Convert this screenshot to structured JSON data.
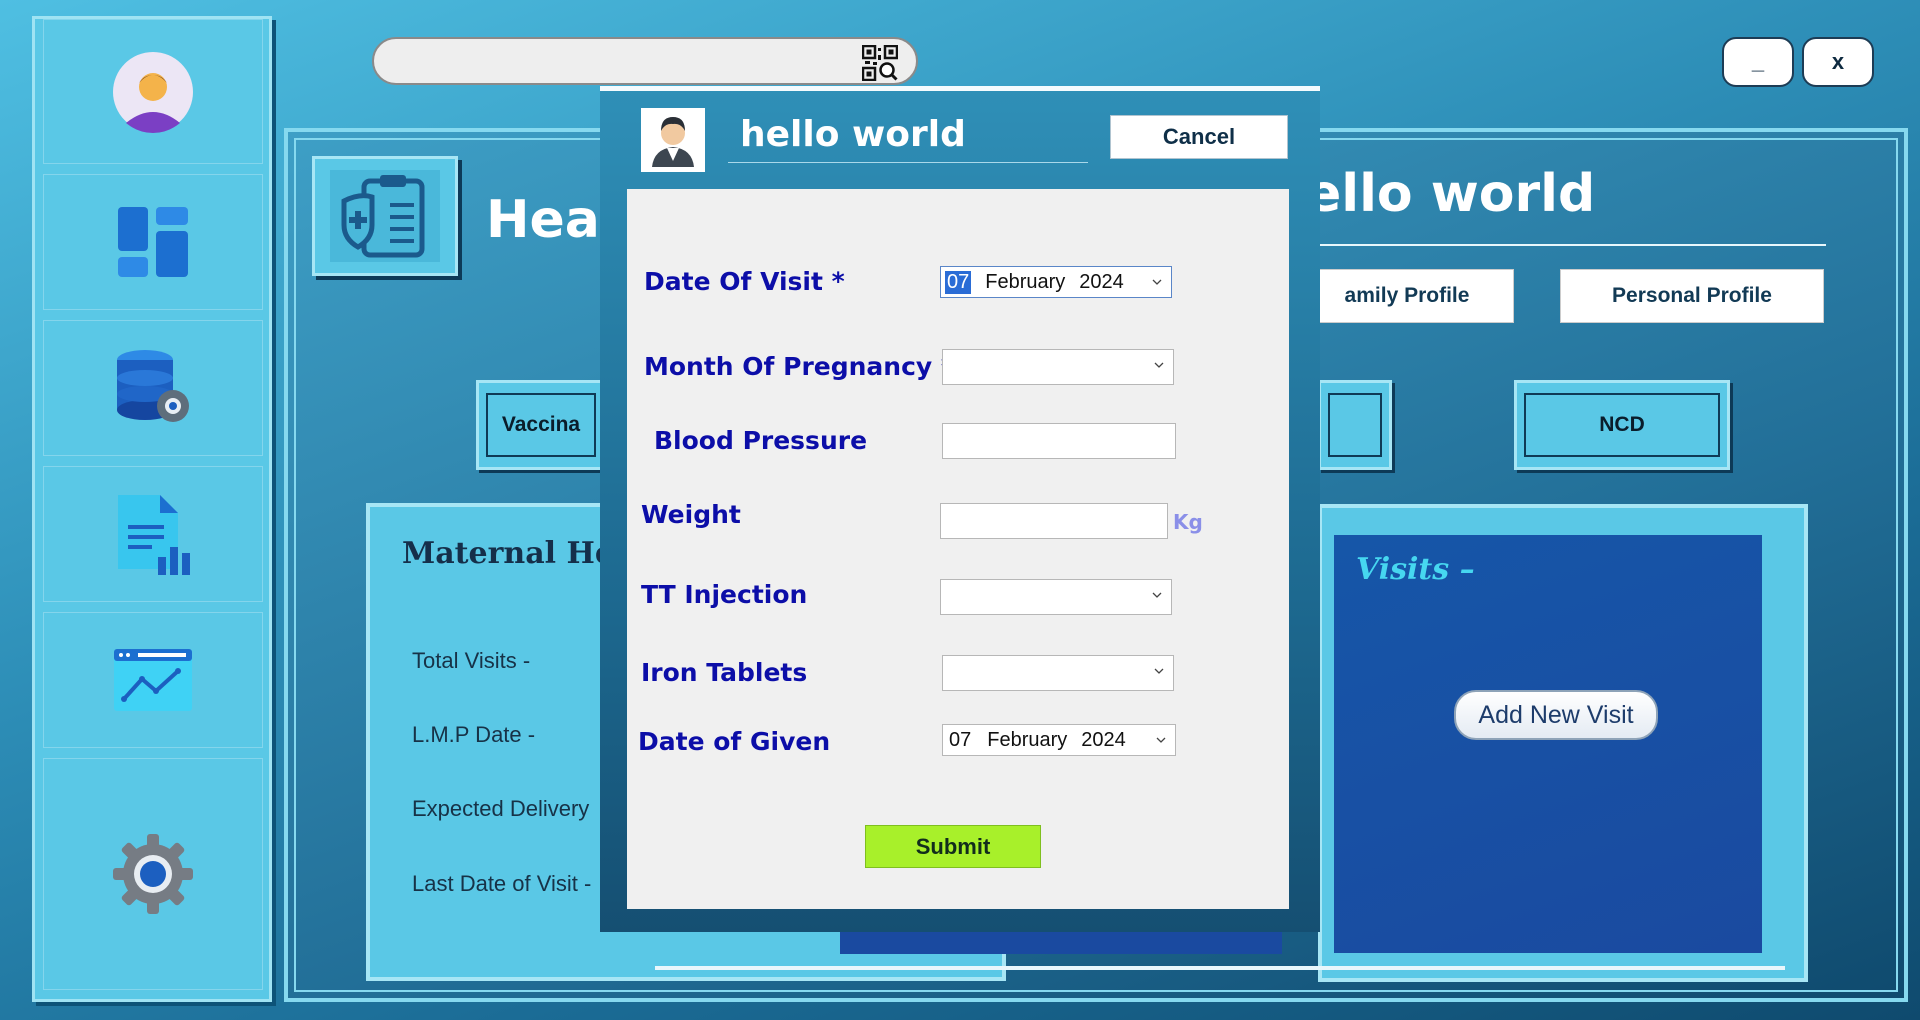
{
  "search": {
    "placeholder": ""
  },
  "window": {
    "minimize_label": "_",
    "close_label": "x"
  },
  "sidebar": {
    "items": [
      {
        "icon": "user-avatar-icon"
      },
      {
        "icon": "dashboard-icon"
      },
      {
        "icon": "database-settings-icon"
      },
      {
        "icon": "report-icon"
      },
      {
        "icon": "analytics-icon"
      },
      {
        "icon": "settings-gear-icon"
      }
    ]
  },
  "background": {
    "title_left": "Heal",
    "title_right": "ello world",
    "family_profile_label": "amily Profile",
    "personal_profile_label": "Personal Profile",
    "vaccination_label": "Vaccina",
    "ncd_label": "NCD",
    "maternal": {
      "title": "Maternal Health D",
      "total_visits": "Total Visits -",
      "lmp_date": "L.M.P Date -",
      "expected_delivery": "Expected Delivery",
      "last_date_of_visit": "Last Date of Visit -"
    },
    "visits": {
      "title": "Visits –",
      "add_new_visit": "Add New Visit"
    }
  },
  "modal": {
    "title": "hello world",
    "cancel_label": "Cancel",
    "fields": {
      "date_of_visit": {
        "label": "Date Of Visit *",
        "day": "07",
        "month": "February",
        "year": "2024"
      },
      "month_of_pregnancy": {
        "label": "Month Of Pregnancy *",
        "value": ""
      },
      "blood_pressure": {
        "label": "Blood Pressure",
        "value": ""
      },
      "weight": {
        "label": "Weight",
        "value": "",
        "unit": "Kg"
      },
      "tt_injection": {
        "label": "TT Injection",
        "value": ""
      },
      "iron_tablets": {
        "label": "Iron Tablets",
        "value": ""
      },
      "date_of_given": {
        "label": "Date of Given",
        "day": "07",
        "month": "February",
        "year": "2024"
      }
    },
    "submit_label": "Submit"
  },
  "colors": {
    "form_label": "#0c0ea8",
    "submit_bg": "#a8f02a",
    "sidebar_bg": "#5ac8e6",
    "visits_panel": "#1a4aa0"
  }
}
